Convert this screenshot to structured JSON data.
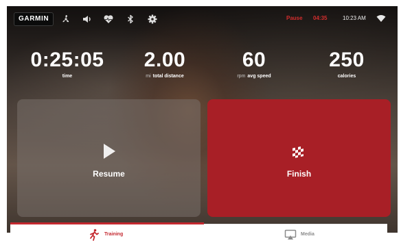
{
  "topbar": {
    "brand": "GARMIN",
    "icons": [
      "fan-icon",
      "speaker-icon",
      "heart-rate-icon",
      "bluetooth-icon",
      "gear-icon"
    ],
    "status": "Pause",
    "elapsed": "04:35",
    "clock": "10:23 AM",
    "wifi_icon": "wifi-icon"
  },
  "metrics": {
    "time": {
      "value": "0:25:05",
      "unit": "",
      "label": "time"
    },
    "distance": {
      "value": "2.00",
      "unit": "mi",
      "label": "total distance"
    },
    "speed": {
      "value": "60",
      "unit": "rpm",
      "label": "avg speed"
    },
    "calories": {
      "value": "250",
      "unit": "",
      "label": "calories"
    }
  },
  "actions": {
    "resume": {
      "label": "Resume",
      "icon": "play-icon"
    },
    "finish": {
      "label": "Finish",
      "icon": "checkered-flag-icon"
    }
  },
  "tabs": [
    {
      "label": "Training",
      "icon": "runner-icon",
      "active": true
    },
    {
      "label": "Media",
      "icon": "airplay-icon",
      "active": false
    }
  ],
  "colors": {
    "accent_red": "#c4282f",
    "finish_card": "#a81f26",
    "status_red": "#d42d2d",
    "inactive_tab": "#8a8a8a"
  }
}
